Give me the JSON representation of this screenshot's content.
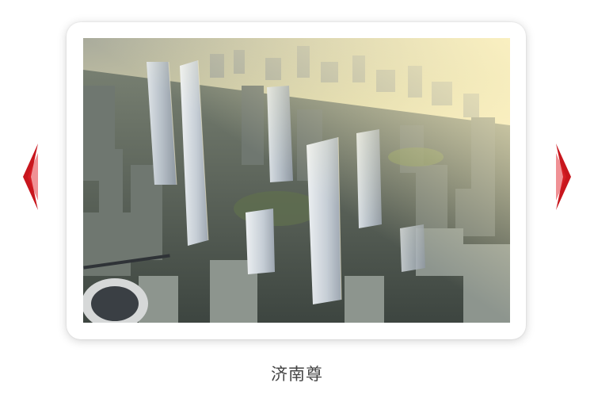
{
  "carousel": {
    "caption": "济南尊",
    "prev_icon": "chevron-left-icon",
    "next_icon": "chevron-right-icon",
    "accent_color": "#c8161d"
  }
}
